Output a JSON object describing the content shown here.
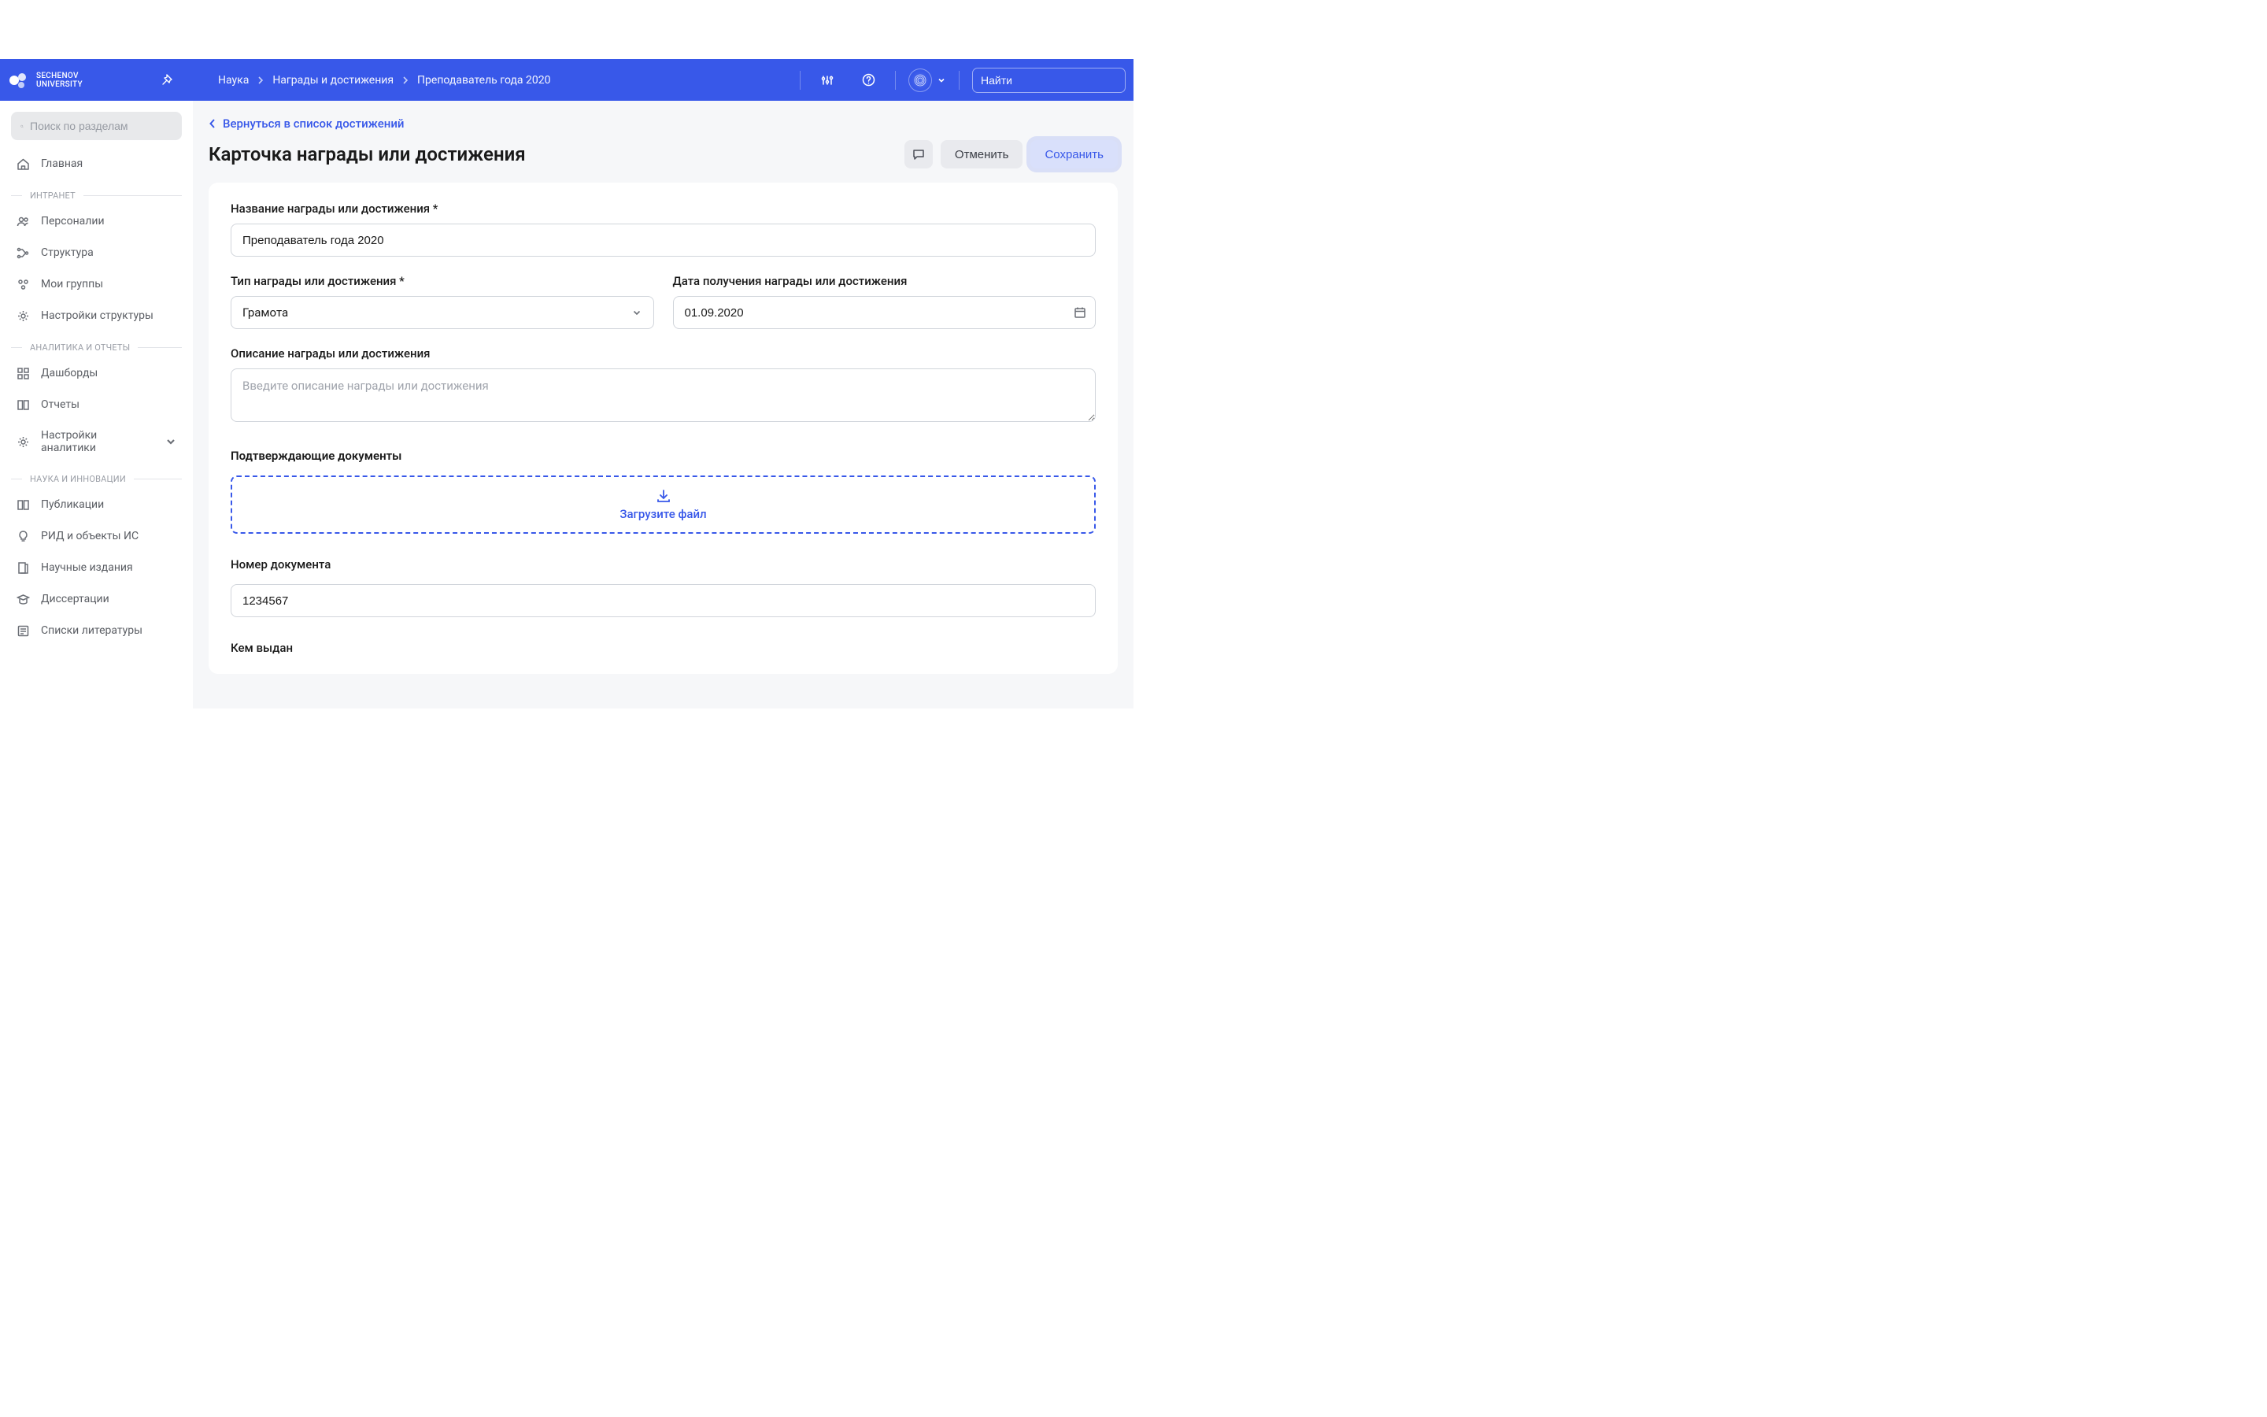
{
  "header": {
    "logo_line1": "SECHENOV",
    "logo_line2": "UNIVERSITY",
    "breadcrumb": [
      "Наука",
      "Награды и достижения",
      "Преподаватель года 2020"
    ],
    "search_placeholder": "Найти"
  },
  "sidebar": {
    "search_placeholder": "Поиск по разделам",
    "home": "Главная",
    "groups": {
      "intranet": {
        "label": "ИНТРАНЕТ",
        "items": [
          "Персоналии",
          "Структура",
          "Мои группы",
          "Настройки структуры"
        ]
      },
      "analytics": {
        "label": "АНАЛИТИКА И ОТЧЕТЫ",
        "items": [
          "Дашборды",
          "Отчеты",
          "Настройки аналитики"
        ]
      },
      "science": {
        "label": "НАУКА И ИННОВАЦИИ",
        "items": [
          "Публикации",
          "РИД и объекты ИС",
          "Научные издания",
          "Диссертации",
          "Списки литературы"
        ]
      }
    }
  },
  "main": {
    "back": "Вернуться в список достижений",
    "title": "Карточка награды или достижения",
    "cancel": "Отменить",
    "save": "Сохранить",
    "labels": {
      "name": "Название награды или достижения *",
      "type": "Тип награды или достижения *",
      "date": "Дата получения награды или достижения",
      "desc": "Описание награды или достижения",
      "docs": "Подтверждающие документы",
      "upload": "Загрузите файл",
      "number": "Номер документа",
      "issuer": "Кем выдан"
    },
    "values": {
      "name": "Преподаватель года 2020",
      "type": "Грамота",
      "date": "01.09.2020",
      "desc_placeholder": "Введите описание награды или достижения",
      "number": "1234567"
    }
  }
}
